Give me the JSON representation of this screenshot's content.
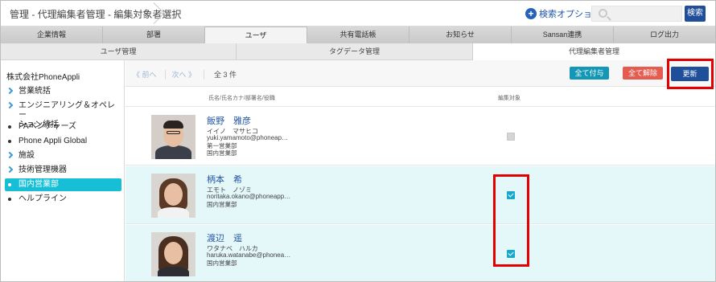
{
  "header": {
    "breadcrumb": "管理 - 代理編集者管理 - 編集対象者選択",
    "search_option_label": "検索オプション",
    "search_placeholder": "",
    "search_button": "検索"
  },
  "main_tabs": [
    {
      "label": "企業情報"
    },
    {
      "label": "部署"
    },
    {
      "label": "ユーザ",
      "active": true
    },
    {
      "label": "共有電話帳"
    },
    {
      "label": "お知らせ"
    },
    {
      "label": "Sansan連携"
    },
    {
      "label": "ログ出力"
    }
  ],
  "sub_tabs": [
    {
      "label": "ユーザ管理"
    },
    {
      "label": "タグデータ管理"
    },
    {
      "label": "代理編集者管理",
      "active": true
    }
  ],
  "sidebar": {
    "company": "株式会社PhoneAppli",
    "items": [
      {
        "label": "営業統括",
        "icon": "chevron-right-icon"
      },
      {
        "label": "エンジニアリング＆オペレー",
        "label2": "ション統括",
        "icon": "chevron-right-icon"
      },
      {
        "label": "PAベンチャーズ",
        "icon": "bullet-icon"
      },
      {
        "label": "Phone Appli Global",
        "icon": "bullet-icon"
      },
      {
        "label": "施設",
        "icon": "chevron-right-icon"
      },
      {
        "label": "技術管理機器",
        "icon": "chevron-right-icon"
      },
      {
        "label": "国内営業部",
        "icon": "bullet-icon",
        "active": true
      },
      {
        "label": "ヘルプライン",
        "icon": "bullet-icon"
      }
    ]
  },
  "toolbar": {
    "prev": "《 前へ",
    "next": "次へ 》",
    "count": "全 3 件",
    "grant_all": "全て付与",
    "clear_all": "全て解除",
    "update": "更新"
  },
  "table": {
    "col_name": "氏名/氏名カナ/部署名/役職",
    "col_edit": "編集対象",
    "rows": [
      {
        "name": "飯野　雅彦",
        "kana": "イイノ　マサヒコ",
        "email": "yuki.yamamoto@phoneap…",
        "dept1": "第一営業部",
        "dept2": "国内営業部",
        "checked": false
      },
      {
        "name": "柄本　希",
        "kana": "エモト　ノゾミ",
        "email": "noritaka.okano@phoneapp…",
        "dept1": "国内営業部",
        "dept2": "",
        "checked": true
      },
      {
        "name": "渡辺　遥",
        "kana": "ワタナベ　ハルカ",
        "email": "haruka.watanabe@phonea…",
        "dept1": "国内営業部",
        "dept2": "",
        "checked": true
      }
    ]
  },
  "colors": {
    "accent": "#1f4e9b",
    "active_sidebar": "#17bfd6",
    "checked_row": "#e4f7f9",
    "highlight": "#e40000"
  }
}
